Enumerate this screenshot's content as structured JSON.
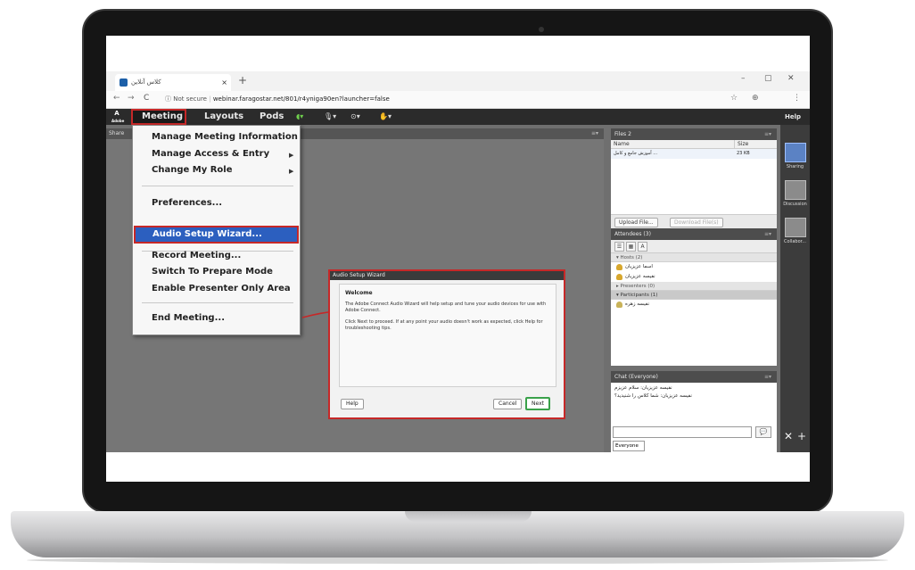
{
  "browser": {
    "tab_title": "کلاس آنلاین",
    "tab_close": "×",
    "new_tab": "+",
    "window_controls": [
      "–",
      "▢",
      "✕"
    ],
    "nav_back": "←",
    "nav_forward": "→",
    "nav_reload": "C",
    "not_secure": "ⓘ Not secure",
    "url": "webinar.faragostar.net/801/r4yniga90en?launcher=false",
    "addr_icons": [
      "☆",
      "⊕",
      "⋮"
    ]
  },
  "app": {
    "logo": "Adobe",
    "menu": {
      "meeting": "Meeting",
      "layouts": "Layouts",
      "pods": "Pods",
      "help": "Help"
    },
    "share_title": "Share",
    "share_ctl": "≡▾",
    "dropdown": {
      "items": [
        "Manage Meeting Information",
        "Manage Access & Entry",
        "Change My Role",
        "Preferences...",
        "Audio Setup Wizard...",
        "Record Meeting...",
        "Switch To Prepare Mode",
        "Enable Presenter Only Area",
        "End Meeting..."
      ],
      "arrow": "▶",
      "selected": "Audio Setup Wizard..."
    },
    "wizard": {
      "title": "Audio Setup Wizard",
      "heading": "Welcome",
      "para1": "The Adobe Connect Audio Wizard will help setup and tune your audio devices for use with Adobe Connect.",
      "para2": "Click Next to proceed. If at any point your audio doesn't work as expected, click Help for troubleshooting tips.",
      "help": "Help",
      "cancel": "Cancel",
      "next": "Next"
    },
    "files": {
      "title": "Files 2",
      "col_name": "Name",
      "col_size": "Size",
      "rows": [
        {
          "name": "آموزش جامع و کامل ...",
          "size": "23 KB"
        }
      ],
      "upload": "Upload File...",
      "download": "Download File(s)"
    },
    "attendees": {
      "title": "Attendees (3)",
      "hosts": "▾ Hosts (2)",
      "host_people": [
        "اسما عزیزیان",
        "نفیسه عزیزیان"
      ],
      "presenters": "▸ Presenters (0)",
      "participants": "▾ Participants (1)",
      "participant_people": [
        "نفیسه زهره"
      ]
    },
    "chat": {
      "title": "Chat (Everyone)",
      "messages": [
        "نفیسه عزیزیان: سلام عزیزم",
        "نفیسه عزیزیان: شما کلاس را شنیدید؟"
      ],
      "send": "💬",
      "tab": "Everyone"
    },
    "layouts_panel": [
      "Sharing",
      "Discussion",
      "Collabor..."
    ],
    "layouts_bottom": [
      "✕",
      "+"
    ],
    "pod_ctl": "≡▾"
  }
}
